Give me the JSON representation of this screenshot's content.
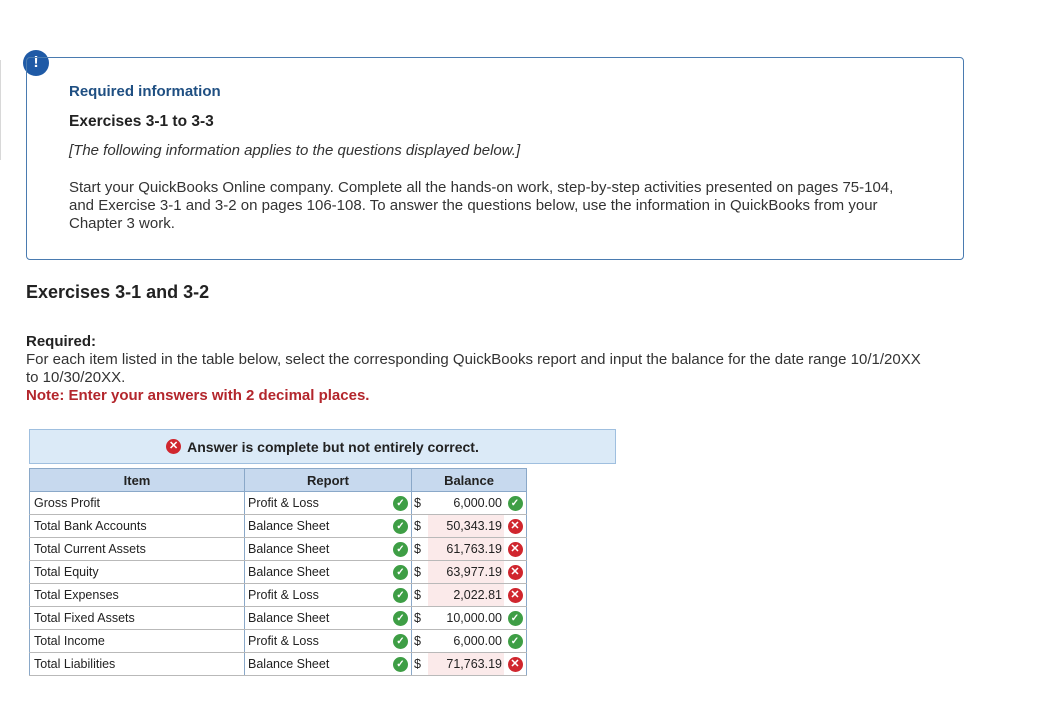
{
  "alert_icon": "!",
  "info": {
    "title": "Required information",
    "subtitle": "Exercises 3-1 to 3-3",
    "note": "[The following information applies to the questions displayed below.]",
    "body": "Start your QuickBooks Online company. Complete all the hands-on work, step-by-step activities presented on pages 75-104, and Exercise 3-1 and 3-2 on pages 106-108. To answer the questions below, use the information in QuickBooks from your Chapter 3 work."
  },
  "section_heading": "Exercises 3-1 and 3-2",
  "required": {
    "label": "Required:",
    "text": "For each item listed in the table below, select the corresponding QuickBooks report and input the balance for the date range 10/1/20XX to 10/30/20XX.",
    "note": "Note: Enter your answers with 2 decimal places."
  },
  "status": {
    "text": "Answer is complete but not entirely correct.",
    "icon": "x-circle-icon",
    "color": "#d0262e"
  },
  "table": {
    "headers": {
      "item": "Item",
      "report": "Report",
      "balance": "Balance"
    },
    "rows": [
      {
        "item": "Gross Profit",
        "report": "Profit & Loss",
        "report_correct": true,
        "currency": "$",
        "balance": "6,000.00",
        "balance_correct": true
      },
      {
        "item": "Total Bank Accounts",
        "report": "Balance Sheet",
        "report_correct": true,
        "currency": "$",
        "balance": "50,343.19",
        "balance_correct": false
      },
      {
        "item": "Total Current Assets",
        "report": "Balance Sheet",
        "report_correct": true,
        "currency": "$",
        "balance": "61,763.19",
        "balance_correct": false
      },
      {
        "item": "Total Equity",
        "report": "Balance Sheet",
        "report_correct": true,
        "currency": "$",
        "balance": "63,977.19",
        "balance_correct": false
      },
      {
        "item": "Total Expenses",
        "report": "Profit & Loss",
        "report_correct": true,
        "currency": "$",
        "balance": "2,022.81",
        "balance_correct": false
      },
      {
        "item": "Total Fixed Assets",
        "report": "Balance Sheet",
        "report_correct": true,
        "currency": "$",
        "balance": "10,000.00",
        "balance_correct": true
      },
      {
        "item": "Total Income",
        "report": "Profit & Loss",
        "report_correct": true,
        "currency": "$",
        "balance": "6,000.00",
        "balance_correct": true
      },
      {
        "item": "Total Liabilities",
        "report": "Balance Sheet",
        "report_correct": true,
        "currency": "$",
        "balance": "71,763.19",
        "balance_correct": false
      }
    ]
  },
  "colors": {
    "correct": "#3e9e45",
    "incorrect": "#d0262e",
    "header_bg": "#c7d9ee",
    "status_bg": "#dbeaf7",
    "accent": "#1f4f82"
  }
}
